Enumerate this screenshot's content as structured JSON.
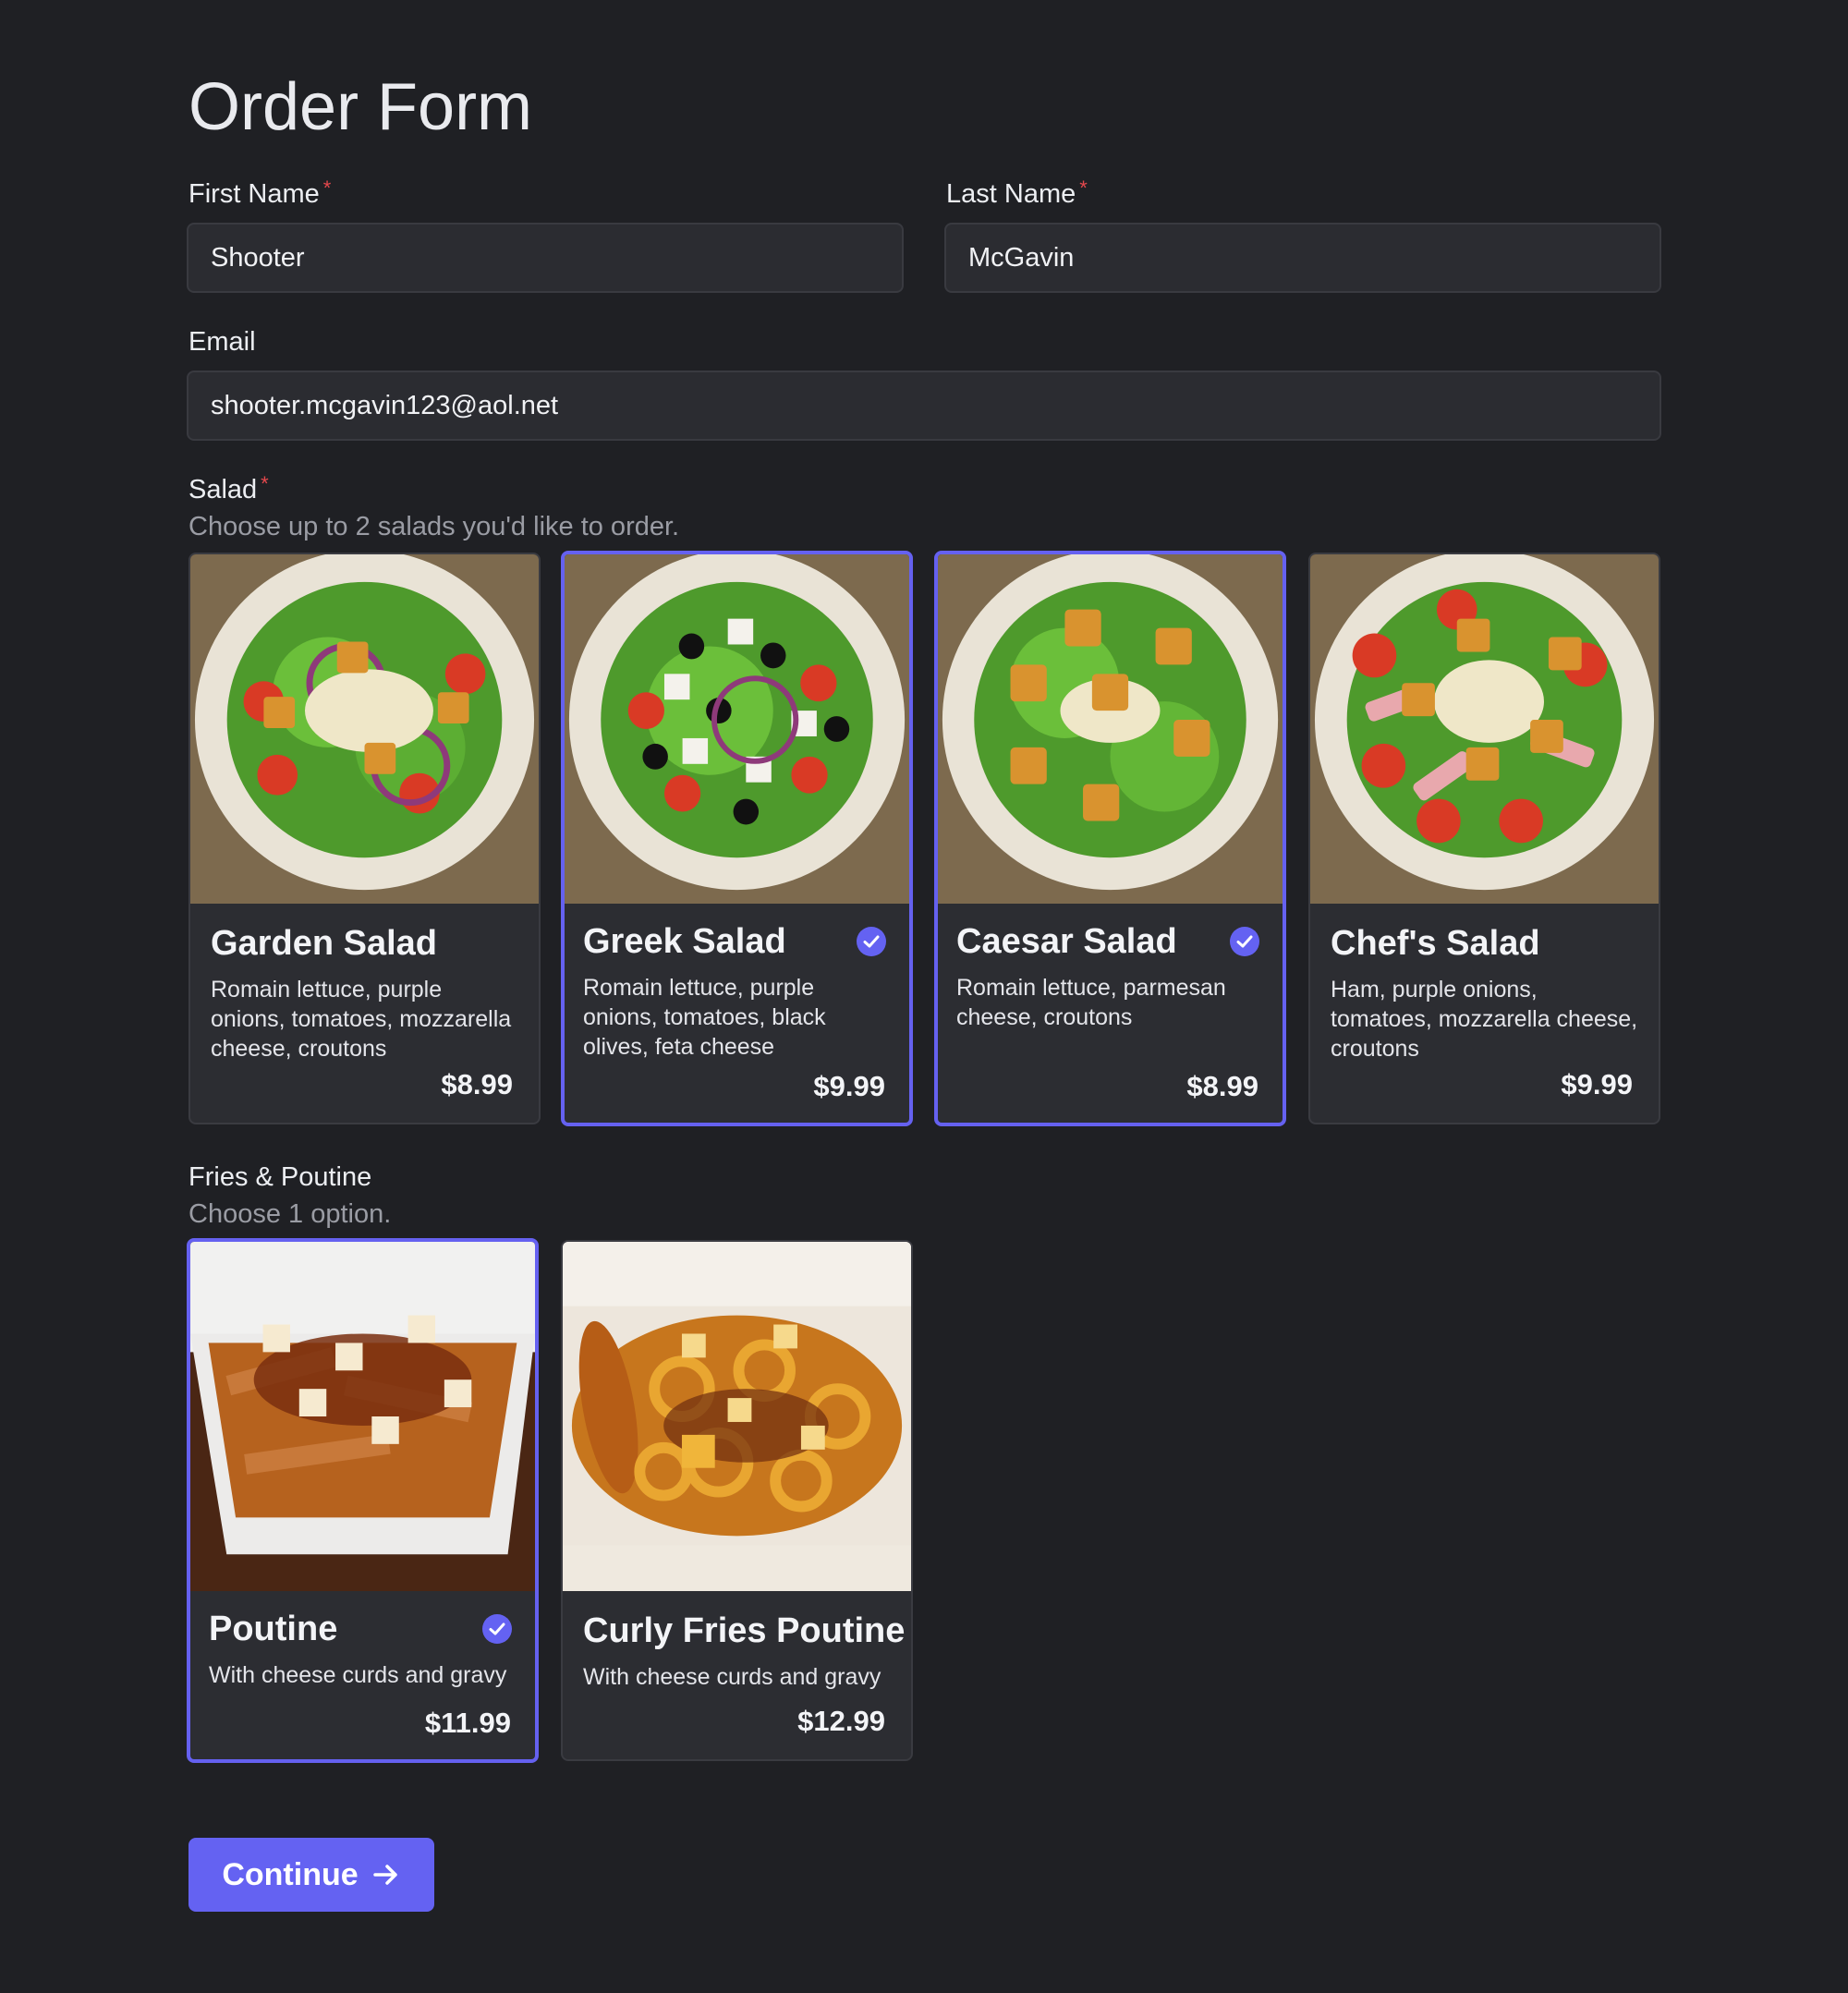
{
  "form": {
    "title": "Order Form",
    "first_name": {
      "label": "First Name",
      "required_mark": "*",
      "value": "Shooter"
    },
    "last_name": {
      "label": "Last Name",
      "required_mark": "*",
      "value": "McGavin"
    },
    "email": {
      "label": "Email",
      "value": "shooter.mcgavin123@aol.net"
    }
  },
  "salad": {
    "label": "Salad",
    "required_mark": "*",
    "hint": "Choose up to 2 salads you'd like to order.",
    "items": [
      {
        "name": "Garden Salad",
        "desc": "Romain lettuce, purple onions, tomatoes, mozzarella cheese, croutons",
        "price": "$8.99",
        "selected": false
      },
      {
        "name": "Greek Salad",
        "desc": "Romain lettuce, purple onions, tomatoes, black olives, feta cheese",
        "price": "$9.99",
        "selected": true
      },
      {
        "name": "Caesar Salad",
        "desc": "Romain lettuce, parmesan cheese, croutons",
        "price": "$8.99",
        "selected": true
      },
      {
        "name": "Chef's Salad",
        "desc": "Ham, purple onions, tomatoes, mozzarella cheese, croutons",
        "price": "$9.99",
        "selected": false
      }
    ]
  },
  "fries": {
    "label": "Fries & Poutine",
    "hint": "Choose 1 option.",
    "items": [
      {
        "name": "Poutine",
        "desc": "With cheese curds and gravy",
        "price": "$11.99",
        "selected": true
      },
      {
        "name": "Curly Fries Poutine",
        "desc": "With cheese curds and gravy",
        "price": "$12.99",
        "selected": false
      }
    ]
  },
  "actions": {
    "continue_label": "Continue",
    "continue_icon": "arrow-right-icon"
  },
  "colors": {
    "accent": "#6462f2",
    "background": "#1f2024",
    "card": "#2c2d32",
    "required": "#e5484d"
  }
}
